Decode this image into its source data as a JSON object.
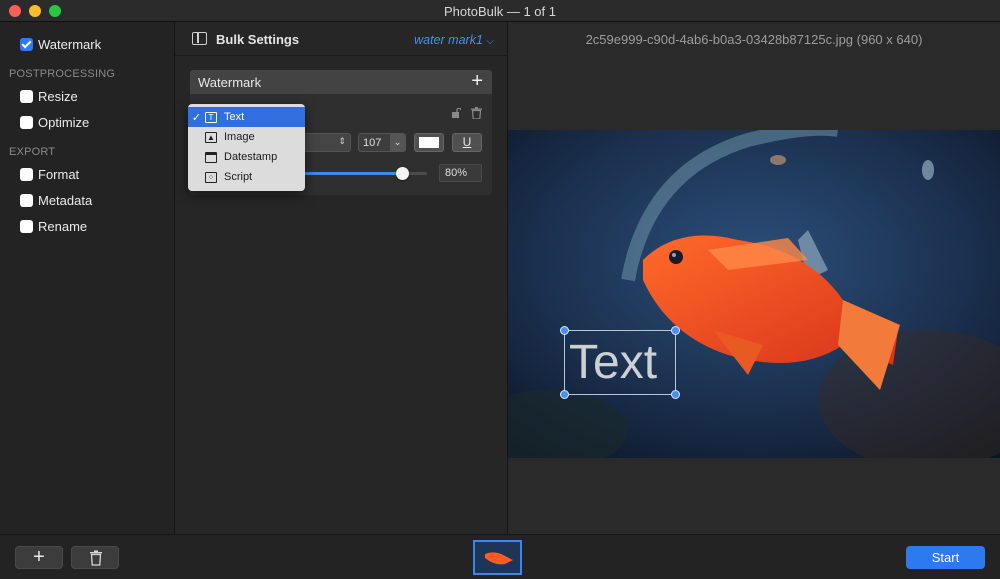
{
  "window": {
    "title": "PhotoBulk — 1 of 1"
  },
  "sidebar": {
    "watermark": {
      "label": "Watermark",
      "checked": true
    },
    "postprocessing_header": "POSTPROCESSING",
    "postprocessing": [
      {
        "label": "Resize",
        "checked": false
      },
      {
        "label": "Optimize",
        "checked": false
      }
    ],
    "export_header": "EXPORT",
    "export": [
      {
        "label": "Format",
        "checked": false
      },
      {
        "label": "Metadata",
        "checked": false
      },
      {
        "label": "Rename",
        "checked": false
      }
    ]
  },
  "settings": {
    "title": "Bulk Settings",
    "preset": "water mark1",
    "watermark_section": "Watermark",
    "font_size": "107",
    "text_color": "#ffffff",
    "underline_label": "U",
    "opacity_value": "80%",
    "opacity_fraction": 0.8
  },
  "type_menu": {
    "items": [
      {
        "label": "Text",
        "icon": "text-icon",
        "selected": true
      },
      {
        "label": "Image",
        "icon": "image-icon",
        "selected": false
      },
      {
        "label": "Datestamp",
        "icon": "calendar-icon",
        "selected": false
      },
      {
        "label": "Script",
        "icon": "script-icon",
        "selected": false
      }
    ]
  },
  "preview": {
    "filename": "2c59e999-c90d-4ab6-b0a3-03428b87125c.jpg (960 x 640)",
    "watermark_text": "Text"
  },
  "bottom": {
    "add_label": "+",
    "start_label": "Start"
  },
  "colors": {
    "accent": "#2d7af0",
    "menu_selected": "#2f6fe0",
    "preset_link": "#4a90e2"
  }
}
